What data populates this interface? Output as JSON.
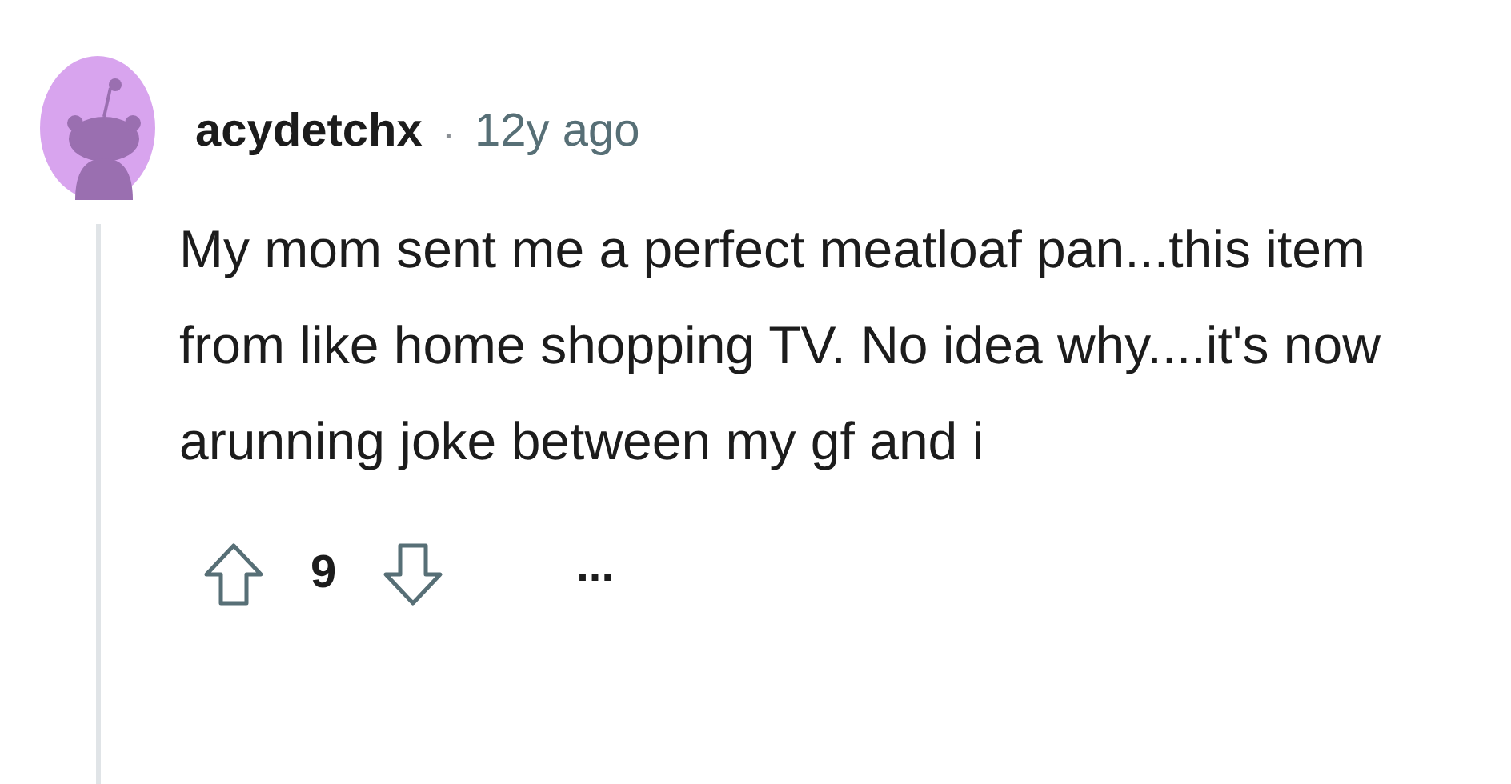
{
  "comment": {
    "author": "acydetchx",
    "separator": "·",
    "time": "12y ago",
    "body": "My mom sent me a perfect meatloaf pan...this item from like home shopping TV. No idea why....it's now arunning joke between my gf and i",
    "score": "9",
    "more": "..."
  }
}
